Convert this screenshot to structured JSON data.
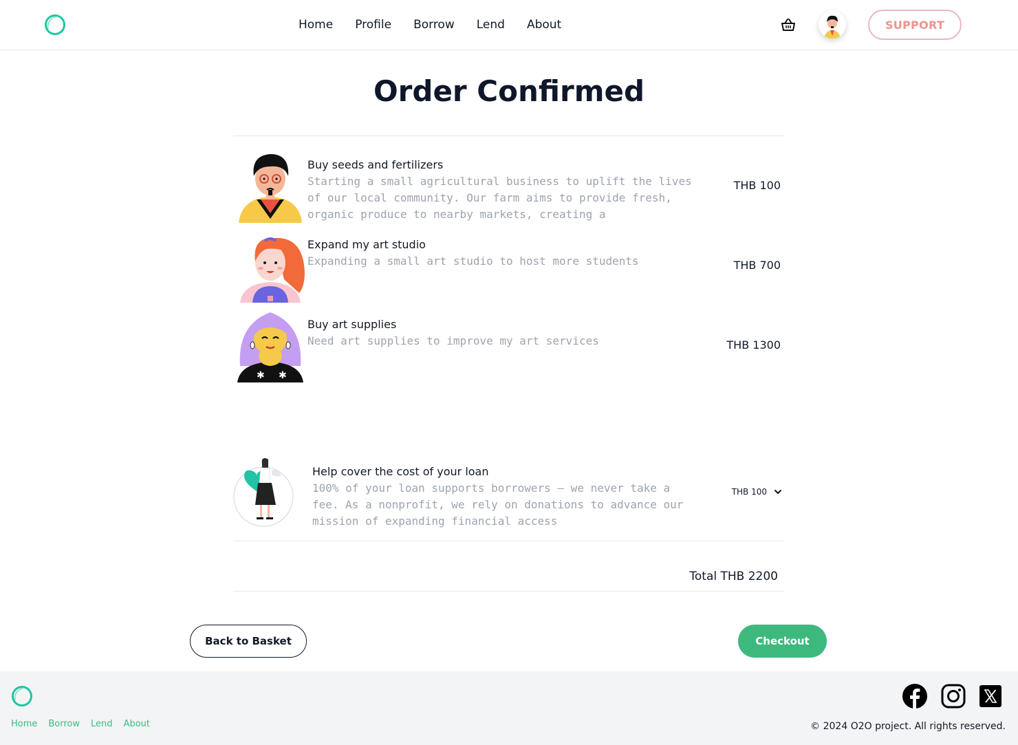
{
  "nav": {
    "links": [
      "Home",
      "Profile",
      "Borrow",
      "Lend",
      "About"
    ],
    "support_label": "SUPPORT"
  },
  "page_title": "Order Confirmed",
  "items": [
    {
      "name": "Buy seeds and fertilizers",
      "description": "Starting a small agricultural business to uplift the lives of our local community. Our farm aims to provide fresh, organic produce to nearby markets, creating a",
      "price": "THB 100"
    },
    {
      "name": "Expand my art studio",
      "description": "Expanding a small art studio to host more students",
      "price": "THB 700"
    },
    {
      "name": "Buy art supplies",
      "description": "Need art supplies to improve my art services",
      "price": "THB 1300"
    }
  ],
  "donation": {
    "title": "Help cover the cost of your loan",
    "description": "100% of your loan supports borrowers — we never take a fee. As a nonprofit, we rely on donations to advance our mission of expanding financial access",
    "selected": "THB 100"
  },
  "total": "Total THB 2200",
  "buttons": {
    "back": "Back to Basket",
    "checkout": "Checkout"
  },
  "footer": {
    "links": [
      "Home",
      "Borrow",
      "Lend",
      "About"
    ],
    "copyright": "© 2024 O2O project. All rights reserved."
  },
  "colors": {
    "accent": "#3eb97d",
    "logo": "#1fc6a0",
    "support_text": "#e8968e"
  },
  "icons": [
    "logo-icon",
    "basket-icon",
    "user-avatar",
    "chevron-down-icon",
    "facebook-icon",
    "instagram-icon",
    "x-icon"
  ]
}
